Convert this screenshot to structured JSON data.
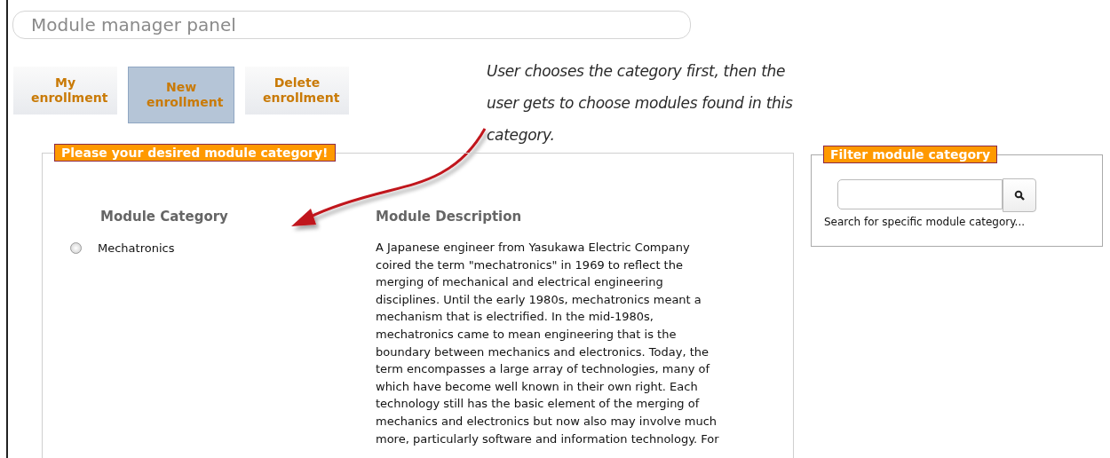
{
  "panel_title": "Module manager panel",
  "tabs": [
    {
      "label": "My enrollment",
      "selected": false
    },
    {
      "label": "New enrollment",
      "selected": true
    },
    {
      "label": "Delete enrollment",
      "selected": false
    }
  ],
  "annotation": {
    "text": "User chooses the category first, then the user gets to choose modules found in this category."
  },
  "category_section": {
    "legend": "Please your desired module category!",
    "columns": [
      "Module Category",
      "Module Description"
    ],
    "rows": [
      {
        "category": "Mechatronics",
        "selected": false,
        "description_lines": [
          "A Japanese engineer from Yasukawa Electric Company",
          "coired the term \"mechatronics\" in 1969 to reflect the",
          "merging of mechanical and electrical engineering",
          "disciplines. Until the early 1980s, mechatronics meant a",
          "mechanism that is electrified. In the mid-1980s,",
          "mechatronics came to mean engineering that is the",
          "boundary between mechanics and electronics. Today, the",
          "term encompasses a large array of technologies, many of",
          "which have become well known in their own right. Each",
          "technology still has the basic element of the merging of",
          "mechanics and electronics but now also may involve much",
          "more, particularly software and information technology. For"
        ]
      }
    ]
  },
  "filter": {
    "legend": "Filter module category",
    "hint": "Search for specific module category..."
  }
}
